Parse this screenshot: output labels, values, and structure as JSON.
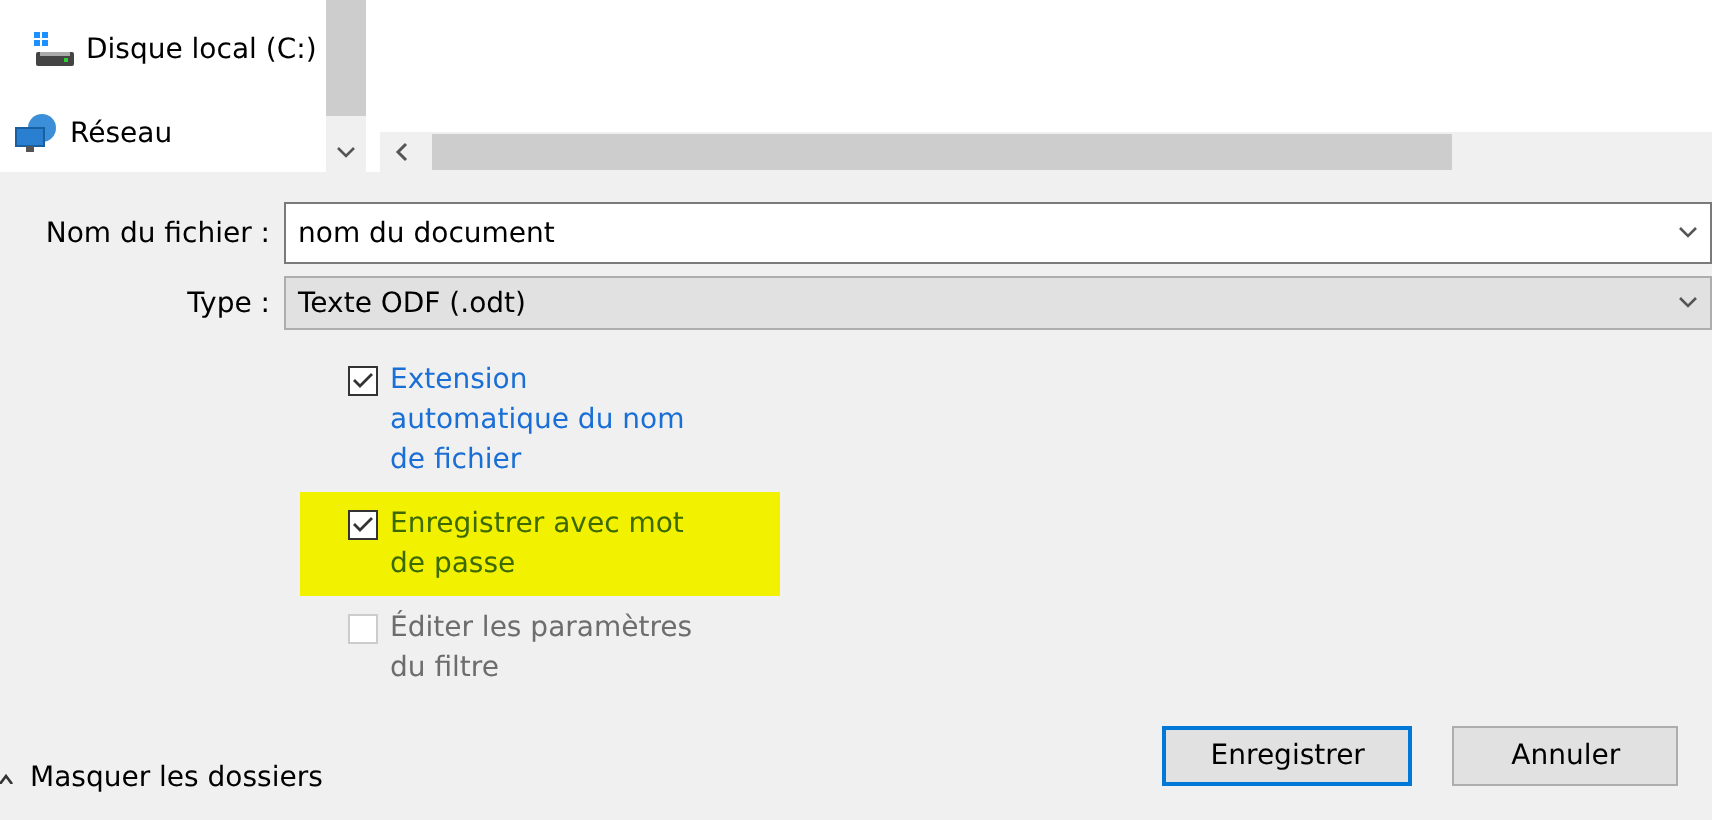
{
  "navigation": {
    "items": [
      {
        "label": "Disque local (C:)",
        "kind": "drive"
      },
      {
        "label": "Réseau",
        "kind": "network"
      }
    ]
  },
  "fields": [
    {
      "label": "Nom du fichier :",
      "value": "nom du document",
      "kind": "input"
    },
    {
      "label": "Type :",
      "value": "Texte ODF (.odt)",
      "kind": "select"
    }
  ],
  "options": [
    {
      "label": "Extension automatique du nom de fichier",
      "checked": true,
      "disabled": false,
      "highlighted": false
    },
    {
      "label": "Enregistrer avec mot de passe",
      "checked": true,
      "disabled": false,
      "highlighted": true
    },
    {
      "label": "Éditer les paramètres du filtre",
      "checked": false,
      "disabled": true,
      "highlighted": false
    }
  ],
  "folders_toggle": {
    "label": "Masquer les dossiers"
  },
  "buttons": [
    {
      "label": "Enregistrer",
      "selected": true
    },
    {
      "label": "Annuler",
      "selected": false
    }
  ]
}
